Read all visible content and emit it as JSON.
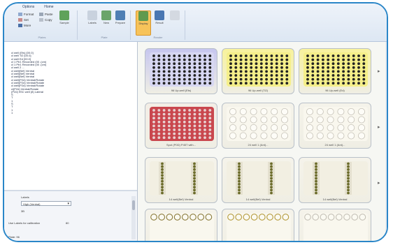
{
  "ribbon": {
    "tabs": [
      "Options",
      "Home"
    ],
    "options": [
      "Format",
      "Set",
      "More"
    ],
    "commands": [
      "Paste",
      "Copy"
    ],
    "group_labels": [
      "Plates",
      "Plate",
      "Reader"
    ],
    "big_buttons": [
      "Sample",
      "Labels",
      "New",
      "Prepare",
      "Display",
      "Result"
    ]
  },
  "tree": {
    "items": [
      "cl well (Ets) [00.0]",
      "cl well Ti2 [00.0]",
      "cl well Ed [00.0]",
      "cl 1 Ptr1 Recorded (00 .(cm)",
      "cl 1 Ptr1 Recorded (00 .(cm)",
      "cl well 2 ...",
      "cl well(Bef) Ventral",
      "cl well(Bef) Ventral",
      "cl well(Bef) Ventral",
      "cl well(P2d) Ventral/Rotate",
      "cl well(P2d) Ventral/Rotate",
      "cl well(P2d) Ventral/Rotate",
      "cl(P2d) Ventral/Rotate",
      "(P2d) 9SC well (8) Lateral",
      "S",
      "T",
      "1",
      "S",
      "T",
      "1",
      "1"
    ]
  },
  "props": {
    "title": "Labels",
    "select_value": "High (Ventral)",
    "field": "3B",
    "option_label": "Use Labels for calibration",
    "option_value": "80",
    "footer": "Plate: 96"
  },
  "plates": [
    {
      "caption": "96 Up-well (Ets)",
      "type": "dots",
      "bg": "#c6c6ef",
      "inner": "#d7d7f2",
      "dot": "#222222",
      "rows": 8,
      "cols": 12
    },
    {
      "caption": "96 Up-well (Ti2)",
      "type": "dots",
      "bg": "#f8f29c",
      "inner": "#f5ef8a",
      "dot": "#222222",
      "rows": 8,
      "cols": 12
    },
    {
      "caption": "96 Up-well (Ed)",
      "type": "dots",
      "bg": "#f8f29c",
      "inner": "#f5ef8a",
      "dot": "#222222",
      "rows": 8,
      "cols": 12
    },
    {
      "caption": "Spot (P0D) P45T with...",
      "type": "dots",
      "bg": "#f3eee6",
      "inner": "#c9474e",
      "dot": "#e8d1d1",
      "rows": 8,
      "cols": 12
    },
    {
      "caption": "24 well 1 (Ant)...",
      "type": "circles",
      "bg": "#f5f3ea",
      "inner": "#f9f7ee",
      "dot": "#c4c0b6",
      "rows": 4,
      "cols": 6
    },
    {
      "caption": "24 well 1 (Ant)...",
      "type": "circles",
      "bg": "#f5f3ea",
      "inner": "#f9f7ee",
      "dot": "#c4c0b6",
      "rows": 4,
      "cols": 6
    },
    {
      "caption": "14 well(Bef) Ventral",
      "type": "strips",
      "bg": "#f5f3ea",
      "inner": "#f2efe2",
      "dot": "#6b6b2a",
      "rows": 11,
      "cols": 2
    },
    {
      "caption": "14 well(Bef) Ventral",
      "type": "strips",
      "bg": "#f5f3ea",
      "inner": "#f2efe2",
      "dot": "#6b6b2a",
      "rows": 11,
      "cols": 2
    },
    {
      "caption": "14 well(Bef) Ventral",
      "type": "strips",
      "bg": "#f5f3ea",
      "inner": "#f2efe2",
      "dot": "#6b6b2a",
      "rows": 11,
      "cols": 2
    },
    {
      "caption": "6 well (P2d) P4T45...",
      "type": "rowcircles",
      "bg": "#f5f3ea",
      "inner": "#f9f7ee",
      "dot": "#8a7a3a",
      "rows": 1,
      "cols": 8
    },
    {
      "caption": "6 well (P2d) P4T45...",
      "type": "rowcircles",
      "bg": "#f5f3ea",
      "inner": "#f9f7ee",
      "dot": "#b49a3b",
      "rows": 1,
      "cols": 8
    },
    {
      "caption": "6 well (P2d) P4T45...",
      "type": "rowcircles",
      "bg": "#f5f3ea",
      "inner": "#f9f7ee",
      "dot": "#c4c0b6",
      "rows": 1,
      "cols": 8
    }
  ],
  "side_arrows": [
    "▸",
    "▸",
    "▸"
  ],
  "colors": {
    "accent": "#2a86c8",
    "highlight": "#f7c35a"
  }
}
